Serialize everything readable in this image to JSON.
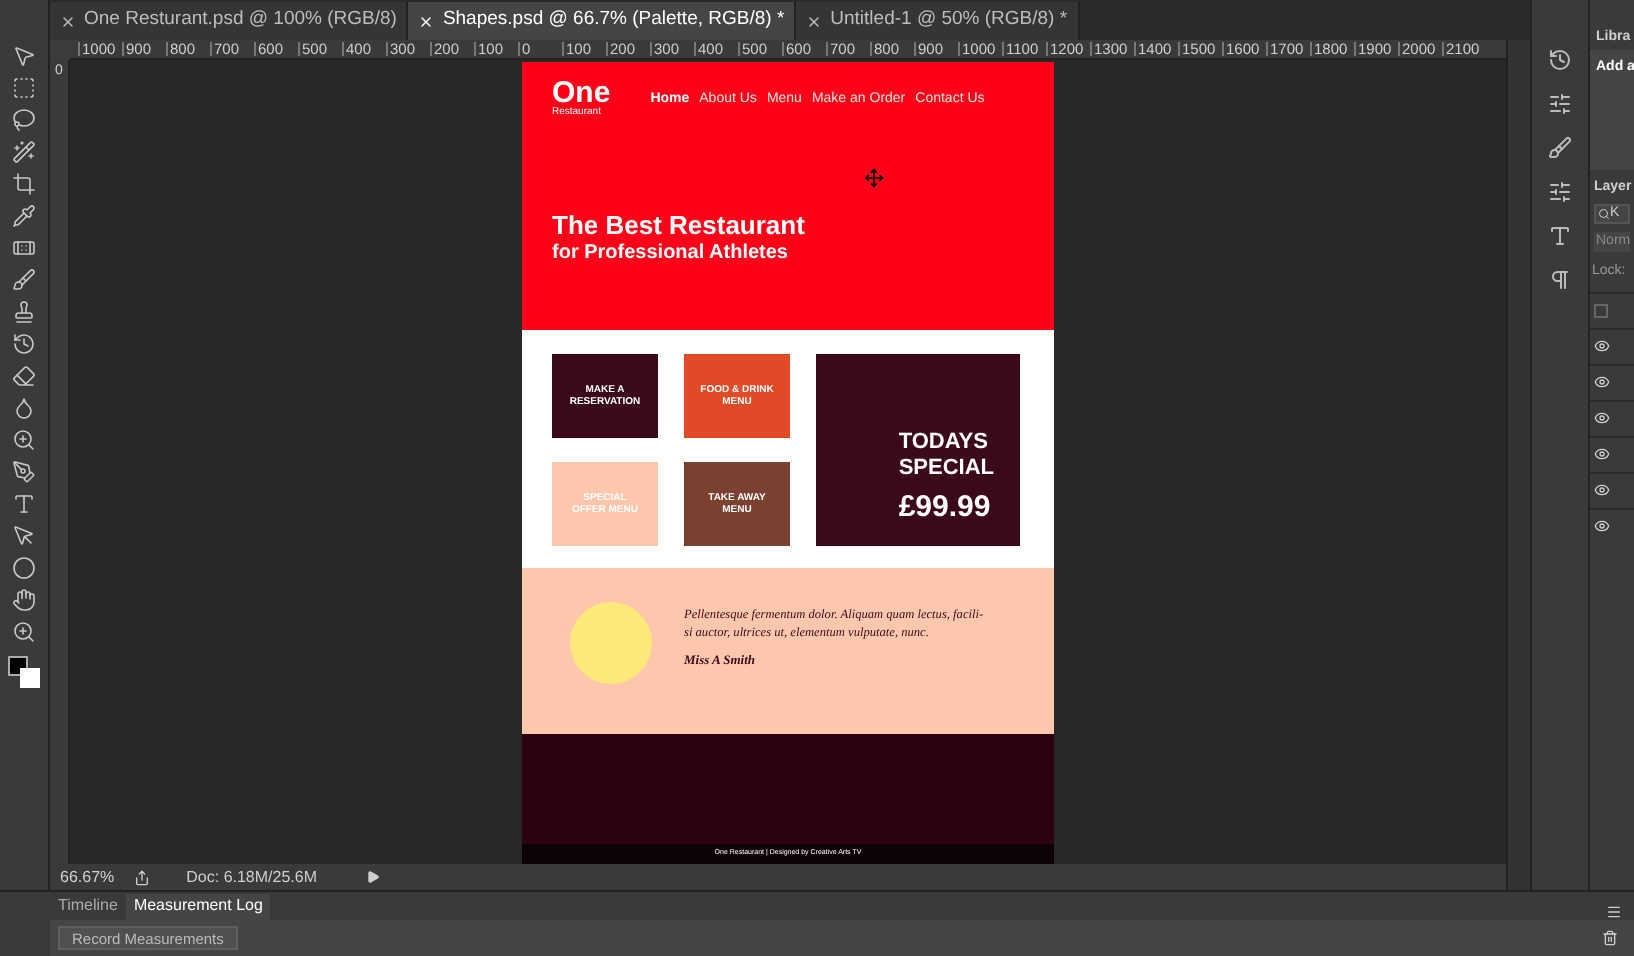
{
  "document_tabs": [
    {
      "label": "One Resturant.psd @ 100% (RGB/8)",
      "selected": false
    },
    {
      "label": "Shapes.psd @ 66.7% (Palette, RGB/8) *",
      "selected": true
    },
    {
      "label": "Untitled-1 @ 50% (RGB/8) *",
      "selected": false
    }
  ],
  "ruler": {
    "horizontal_ticks": [
      "1000",
      "900",
      "800",
      "700",
      "600",
      "500",
      "400",
      "300",
      "200",
      "100",
      "0",
      "100",
      "200",
      "300",
      "400",
      "500",
      "600",
      "700",
      "800",
      "900",
      "1000",
      "1100",
      "1200",
      "1300",
      "1400",
      "1500",
      "1600",
      "1700",
      "1800",
      "1900",
      "2000",
      "2100"
    ],
    "vertical_ticks": [
      "0"
    ]
  },
  "site": {
    "logo": {
      "title": "One",
      "subtitle": "Restaurant"
    },
    "nav": [
      {
        "label": "Home",
        "selected": true
      },
      {
        "label": "About Us",
        "selected": false
      },
      {
        "label": "Menu",
        "selected": false
      },
      {
        "label": "Make an Order",
        "selected": false
      },
      {
        "label": "Contact Us",
        "selected": false
      }
    ],
    "hero": {
      "title": "The Best Restaurant",
      "subtitle": "for Professional Athletes"
    },
    "tiles": [
      {
        "label": "MAKE A RESERVATION",
        "color": "#3b0a1a"
      },
      {
        "label": "FOOD & DRINK MENU",
        "color": "#e04a26"
      },
      {
        "label": "SPECIAL OFFER MENU",
        "color": "#fdc6ad"
      },
      {
        "label": "TAKE AWAY MENU",
        "color": "#7a4030"
      }
    ],
    "special": {
      "lines": [
        "TODAYS",
        "SPECIAL"
      ],
      "price": "£99.99"
    },
    "testimonial": {
      "lines": [
        "Pellentesque fermentum dolor. Aliquam quam lectus, facili-",
        "si auctor, ultrices ut, elementum vulputate, nunc."
      ],
      "author": "Miss A Smith"
    },
    "footer": "One Restaurant | Designed by Creative Arts TV"
  },
  "status_bar": {
    "zoom": "66.67%",
    "doc": "Doc: 6.18M/25.6M"
  },
  "bottom_panel": {
    "tabs": [
      {
        "label": "Timeline",
        "selected": false
      },
      {
        "label": "Measurement Log",
        "selected": true
      }
    ],
    "button": "Record Measurements"
  },
  "right_panel": {
    "libraries_tab": "Libra",
    "add_text": "Add a",
    "layers_tab": "Layer",
    "search": "K",
    "blend_mode": "Norm",
    "lock_label": "Lock:",
    "layers": [
      {
        "visible": false
      },
      {
        "visible": true
      },
      {
        "visible": true
      },
      {
        "visible": true
      },
      {
        "visible": true
      },
      {
        "visible": true
      },
      {
        "visible": true
      }
    ]
  }
}
